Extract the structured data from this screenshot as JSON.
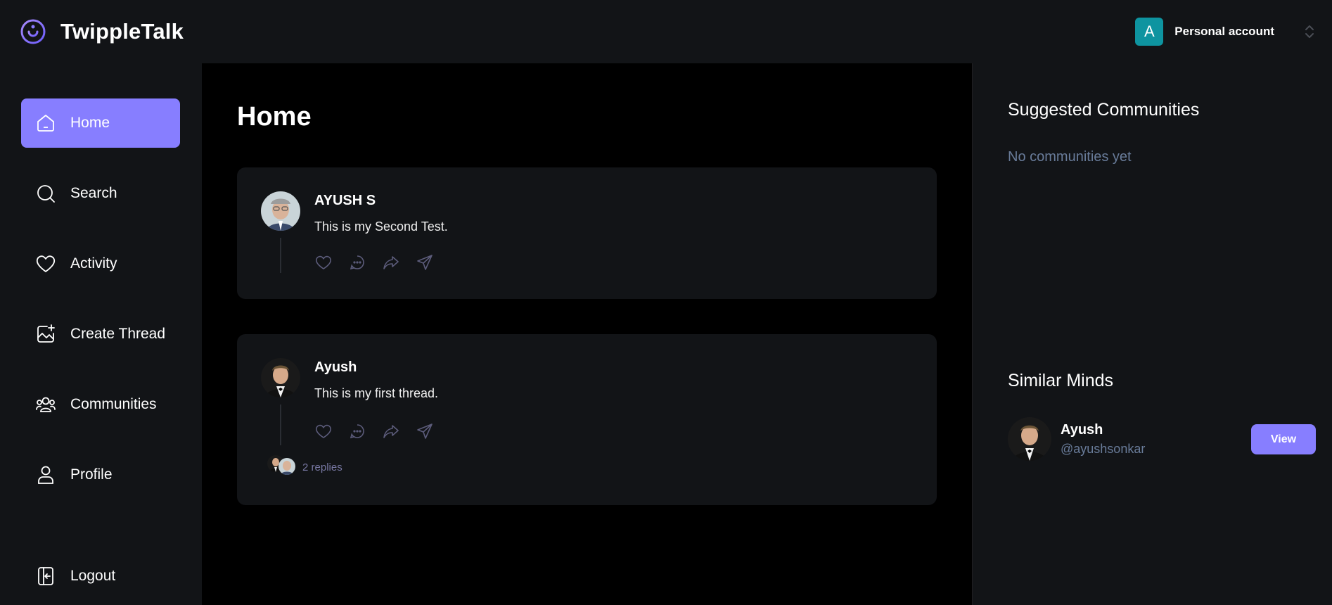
{
  "brand": {
    "name": "TwippleTalk",
    "logo_icon": "logo-icon"
  },
  "account": {
    "initial": "A",
    "label": "Personal account",
    "avatar_color": "#0e94a0"
  },
  "colors": {
    "accent": "#877eff",
    "panel": "#121417",
    "background": "#000000",
    "muted": "#697c9a"
  },
  "sidebar": {
    "items": [
      {
        "label": "Home",
        "icon": "home-icon",
        "active": true
      },
      {
        "label": "Search",
        "icon": "search-icon",
        "active": false
      },
      {
        "label": "Activity",
        "icon": "heart-icon",
        "active": false
      },
      {
        "label": "Create Thread",
        "icon": "create-thread-icon",
        "active": false
      },
      {
        "label": "Communities",
        "icon": "communities-icon",
        "active": false
      },
      {
        "label": "Profile",
        "icon": "user-icon",
        "active": false
      }
    ],
    "logout": {
      "label": "Logout",
      "icon": "logout-icon"
    }
  },
  "main": {
    "title": "Home",
    "threads": [
      {
        "author": "AYUSH S",
        "text": "This is my Second Test."
      },
      {
        "author": "Ayush",
        "text": "This is my first thread.",
        "replies": "2 replies"
      }
    ]
  },
  "right": {
    "suggested_title": "Suggested Communities",
    "suggested_empty": "No communities yet",
    "similar_title": "Similar Minds",
    "mind": {
      "name": "Ayush",
      "handle": "@ayushsonkar",
      "button": "View"
    }
  }
}
